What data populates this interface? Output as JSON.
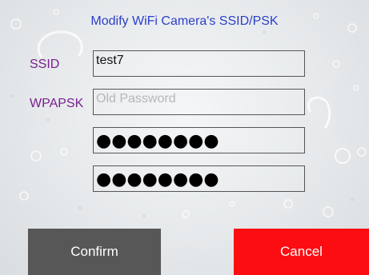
{
  "title": "Modify WiFi Camera's SSID/PSK",
  "labels": {
    "ssid": "SSID",
    "wpapsk": "WPAPSK"
  },
  "fields": {
    "ssid_value": "test7",
    "old_password_placeholder": "Old Password",
    "new_password_masked": "●●●●●●●●",
    "confirm_password_masked": "●●●●●●●●"
  },
  "buttons": {
    "confirm": "Confirm",
    "cancel": "Cancel"
  },
  "colors": {
    "title": "#2b3fc9",
    "label": "#7a1f8e",
    "confirm_bg": "#575757",
    "cancel_bg": "#fc0d12"
  }
}
